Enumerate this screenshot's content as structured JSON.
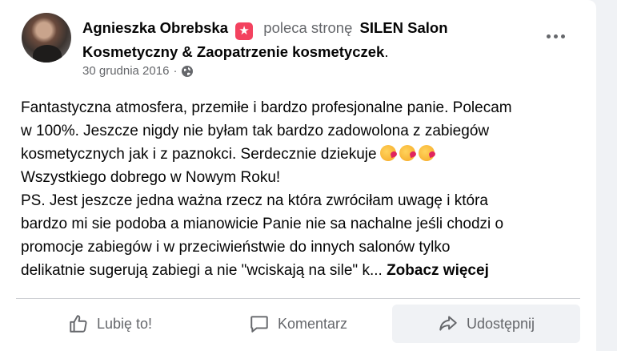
{
  "post": {
    "author": "Agnieszka Obrebska",
    "verb": "poleca stronę",
    "page_name": "SILEN Salon Kosmetyczny & Zaopatrzenie kosmetyczek",
    "page_suffix": ".",
    "date": "30 grudnia 2016",
    "separator": "·",
    "body_lines": [
      "Fantastyczna atmosfera, przemiłe i bardzo profesjonalne panie. Polecam",
      "w 100%. Jeszcze nigdy nie byłam tak bardzo zadowolona z zabiegów",
      "kosmetycznych jak i z paznokci. Serdecznie dziekuje",
      "Wszystkiego dobrego w Nowym Roku!",
      "PS. Jest jeszcze jedna ważna rzecz na która zwróciłam uwagę i która",
      "bardzo mi sie podoba a mianowicie Panie nie sa nachalne jeśli chodzi o",
      "promocje zabiegów i w przeciwieństwie do innych salonów tylko",
      "delikatnie sugerują zabiegi a nie \"wciskają na sile\" k..."
    ],
    "see_more": "Zobacz więcej"
  },
  "icons": {
    "recommend": "star-icon",
    "privacy": "globe-icon",
    "more": "more-options-icon",
    "emoji": "kissing-face-emoji"
  },
  "actions": {
    "like": "Lubię to!",
    "comment": "Komentarz",
    "share": "Udostępnij"
  },
  "colors": {
    "recommend_badge": "#f3425f",
    "secondary_text": "#65676b",
    "primary_text": "#050505"
  }
}
